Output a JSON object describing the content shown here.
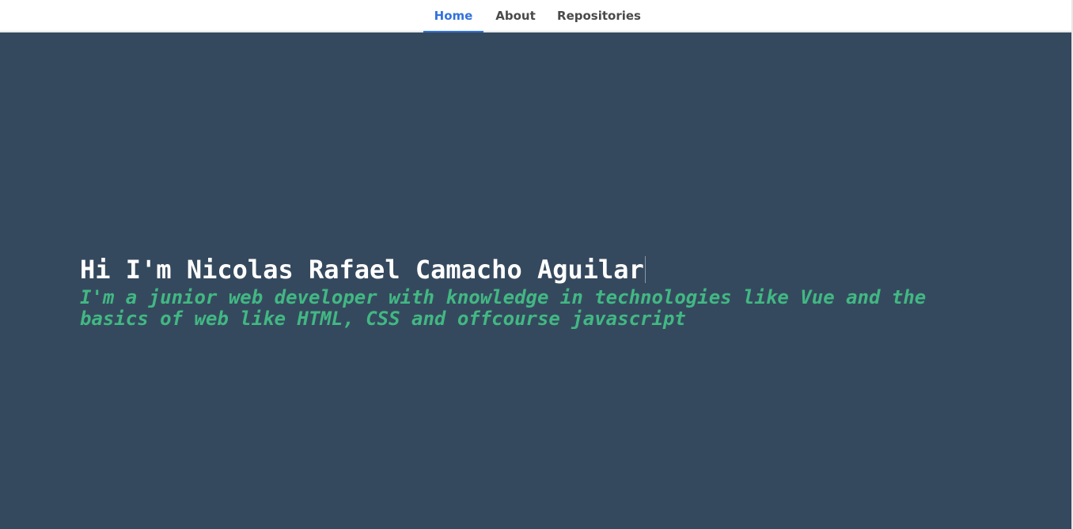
{
  "nav": {
    "tabs": [
      {
        "label": "Home",
        "active": true
      },
      {
        "label": "About",
        "active": false
      },
      {
        "label": "Repositories",
        "active": false
      }
    ]
  },
  "hero": {
    "title": "Hi I'm Nicolas Rafael Camacho Aguilar",
    "subtitle": "I'm a junior web developer with knowledge in technologies like Vue and the basics of web like HTML, CSS and offcourse javascript"
  },
  "colors": {
    "hero_background": "#35495e",
    "accent_green": "#41b883",
    "active_tab": "#3273dc"
  }
}
